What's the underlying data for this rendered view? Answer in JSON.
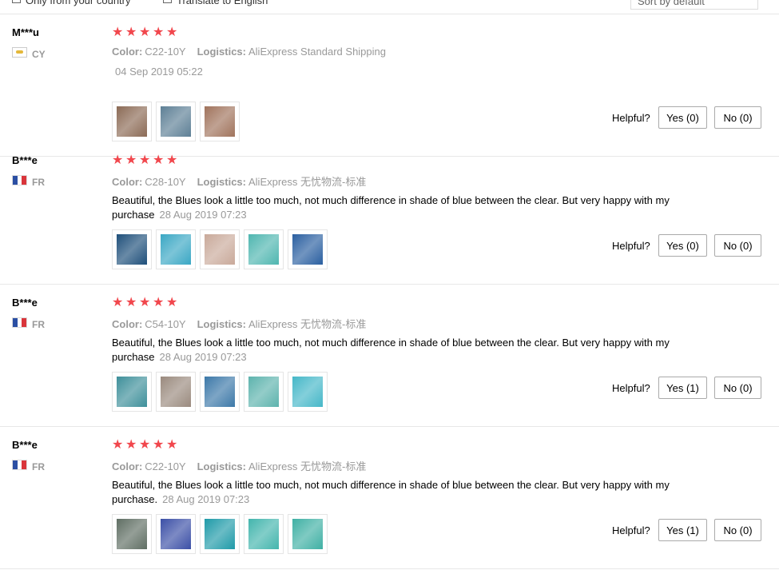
{
  "filters": {
    "only_country": "Only from your country",
    "translate": "Translate to English",
    "sort": "Sort by default"
  },
  "labels": {
    "color": "Color:",
    "logistics": "Logistics:",
    "helpful": "Helpful?"
  },
  "reviews": [
    {
      "user": "M***u",
      "country": "CY",
      "stars": 5,
      "color": "C22-10Y",
      "logistics": "AliExpress Standard Shipping",
      "text": "",
      "date": "04 Sep 2019 05:22",
      "yes": "Yes (0)",
      "no": "No (0)",
      "photos": [
        "#8b6a55",
        "#5d7f95",
        "#a0735c"
      ]
    },
    {
      "user": "B***e",
      "country": "FR",
      "stars": 5,
      "color": "C28-10Y",
      "logistics": "AliExpress 无忧物流-标准",
      "text": "Beautiful, the Blues look a little too much, not much difference in shade of blue between the clear. But very happy with my purchase",
      "date": "28 Aug 2019 07:23",
      "yes": "Yes (0)",
      "no": "No (0)",
      "photos": [
        "#1e4f7a",
        "#3aa7c4",
        "#c9a99a",
        "#4fb6b0",
        "#2a5fa0"
      ]
    },
    {
      "user": "B***e",
      "country": "FR",
      "stars": 5,
      "color": "C54-10Y",
      "logistics": "AliExpress 无忧物流-标准",
      "text": "Beautiful, the Blues look a little too much, not much difference in shade of blue between the clear. But very happy with my purchase",
      "date": "28 Aug 2019 07:23",
      "yes": "Yes (1)",
      "no": "No (0)",
      "photos": [
        "#3e8f9a",
        "#9a8a7e",
        "#3c78a8",
        "#5db3ad",
        "#45b7c8"
      ]
    },
    {
      "user": "B***e",
      "country": "FR",
      "stars": 5,
      "color": "C22-10Y",
      "logistics": "AliExpress 无忧物流-标准",
      "text": "Beautiful, the Blues look a little too much, not much difference in shade of blue between the clear. But very happy with my purchase.",
      "date": "28 Aug 2019 07:23",
      "yes": "Yes (1)",
      "no": "No (0)",
      "photos": [
        "#5f6e63",
        "#3b4fa6",
        "#1f9aa8",
        "#43b5ad",
        "#3fb0a4"
      ]
    }
  ]
}
